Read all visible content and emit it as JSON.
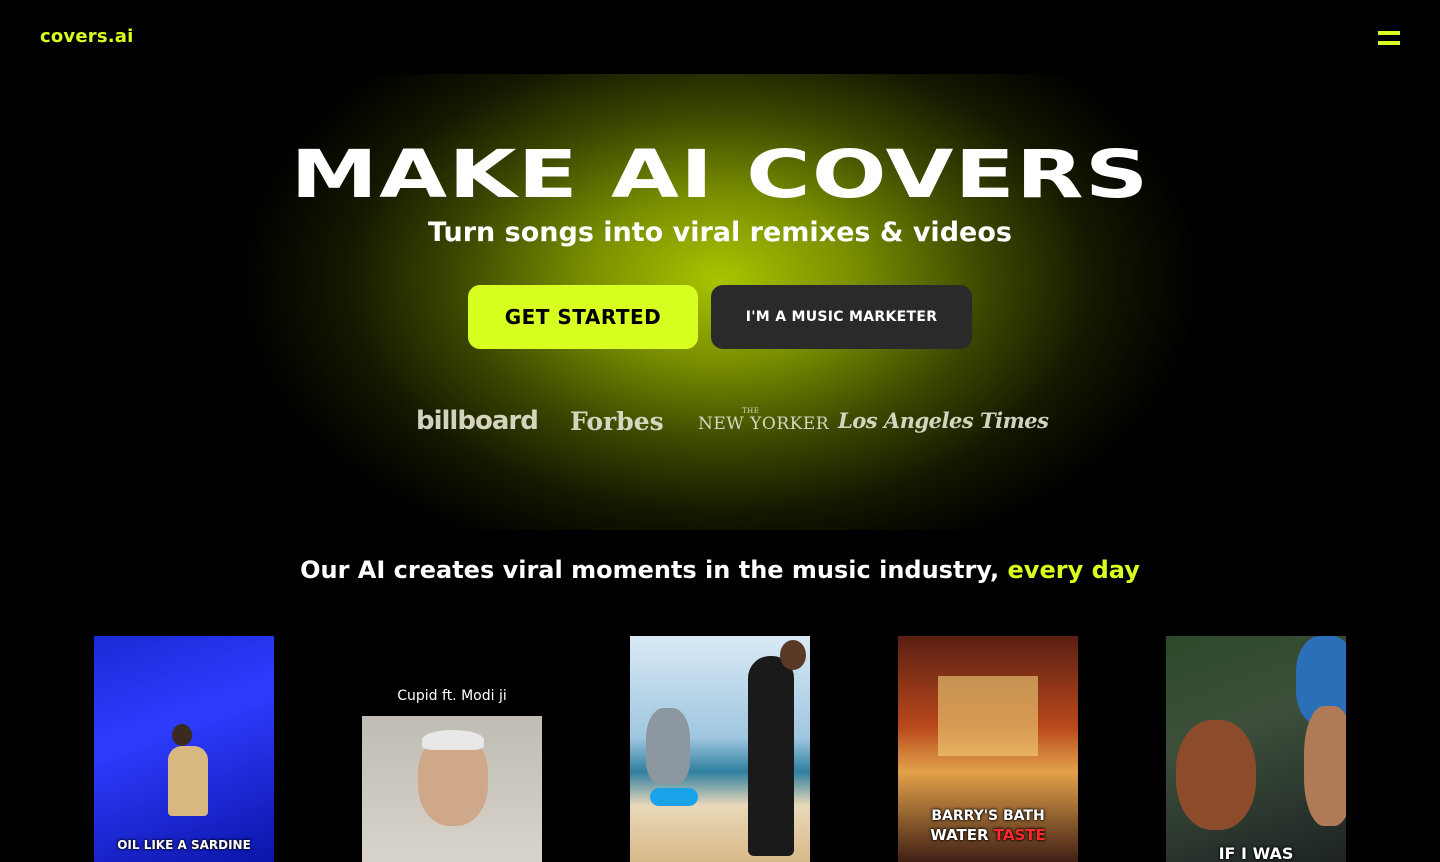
{
  "nav": {
    "logo": "covers.ai",
    "menu_icon": "hamburger-menu-icon"
  },
  "hero": {
    "title": "MAKE AI COVERS",
    "subtitle": "Turn songs into viral remixes & videos",
    "primary_button": "GET STARTED",
    "secondary_button": "I'M A MUSIC MARKETER",
    "press_logos": {
      "billboard": "billboard",
      "forbes": "Forbes",
      "newyorker": "NEW YORKER",
      "newyorker_the": "THE",
      "latimes": "Los Angeles Times"
    }
  },
  "tagline": {
    "main": "Our AI creates viral moments in the music industry, ",
    "accent": "every day"
  },
  "videos": [
    {
      "caption": "OIL LIKE A SARDINE"
    },
    {
      "caption": "Cupid ft. Modi ji"
    },
    {
      "caption": ""
    },
    {
      "caption_line1": "BARRY'S BATH",
      "caption_line2a": "WATER ",
      "caption_line2b": "TASTE"
    },
    {
      "caption": "IF I WAS"
    }
  ],
  "colors": {
    "accent": "#d7ff1f",
    "background": "#000000",
    "secondary_button": "#2a2a2a"
  }
}
